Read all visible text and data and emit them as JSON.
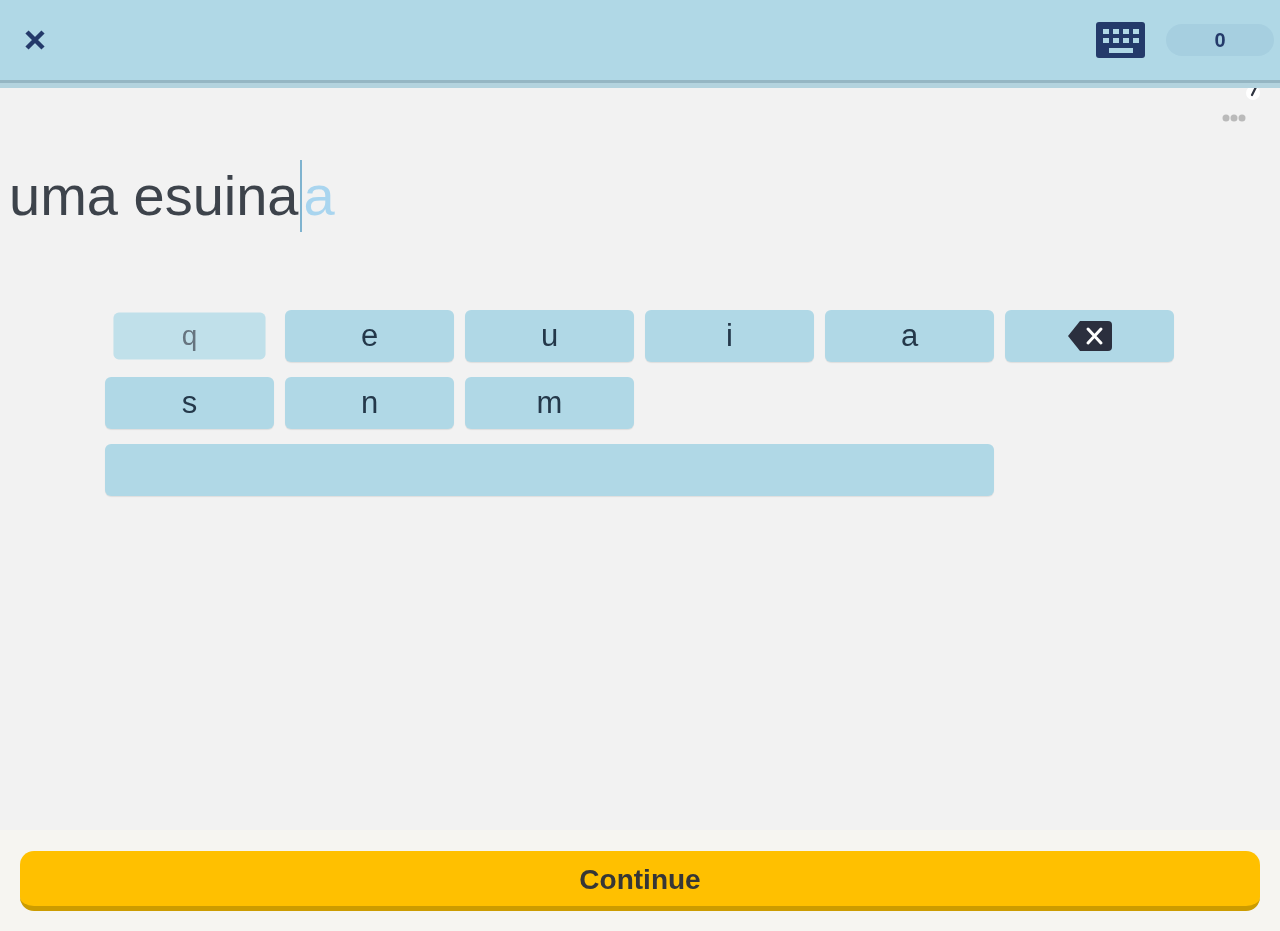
{
  "header": {
    "score": "0"
  },
  "answer": {
    "value": "uma esuina",
    "ghost_text": "a"
  },
  "keyboard": {
    "keys": [
      {
        "kind": "letter",
        "label": "q",
        "pressed": true
      },
      {
        "kind": "letter",
        "label": "e",
        "pressed": false
      },
      {
        "kind": "letter",
        "label": "u",
        "pressed": false
      },
      {
        "kind": "letter",
        "label": "i",
        "pressed": false
      },
      {
        "kind": "letter",
        "label": "a",
        "pressed": false
      },
      {
        "kind": "backspace",
        "pressed": false
      },
      {
        "kind": "letter",
        "label": "s",
        "pressed": false
      },
      {
        "kind": "letter",
        "label": "n",
        "pressed": false
      },
      {
        "kind": "letter",
        "label": "m",
        "pressed": false
      },
      {
        "kind": "space",
        "pressed": false
      }
    ]
  },
  "continue_button": {
    "label": "Continue"
  }
}
